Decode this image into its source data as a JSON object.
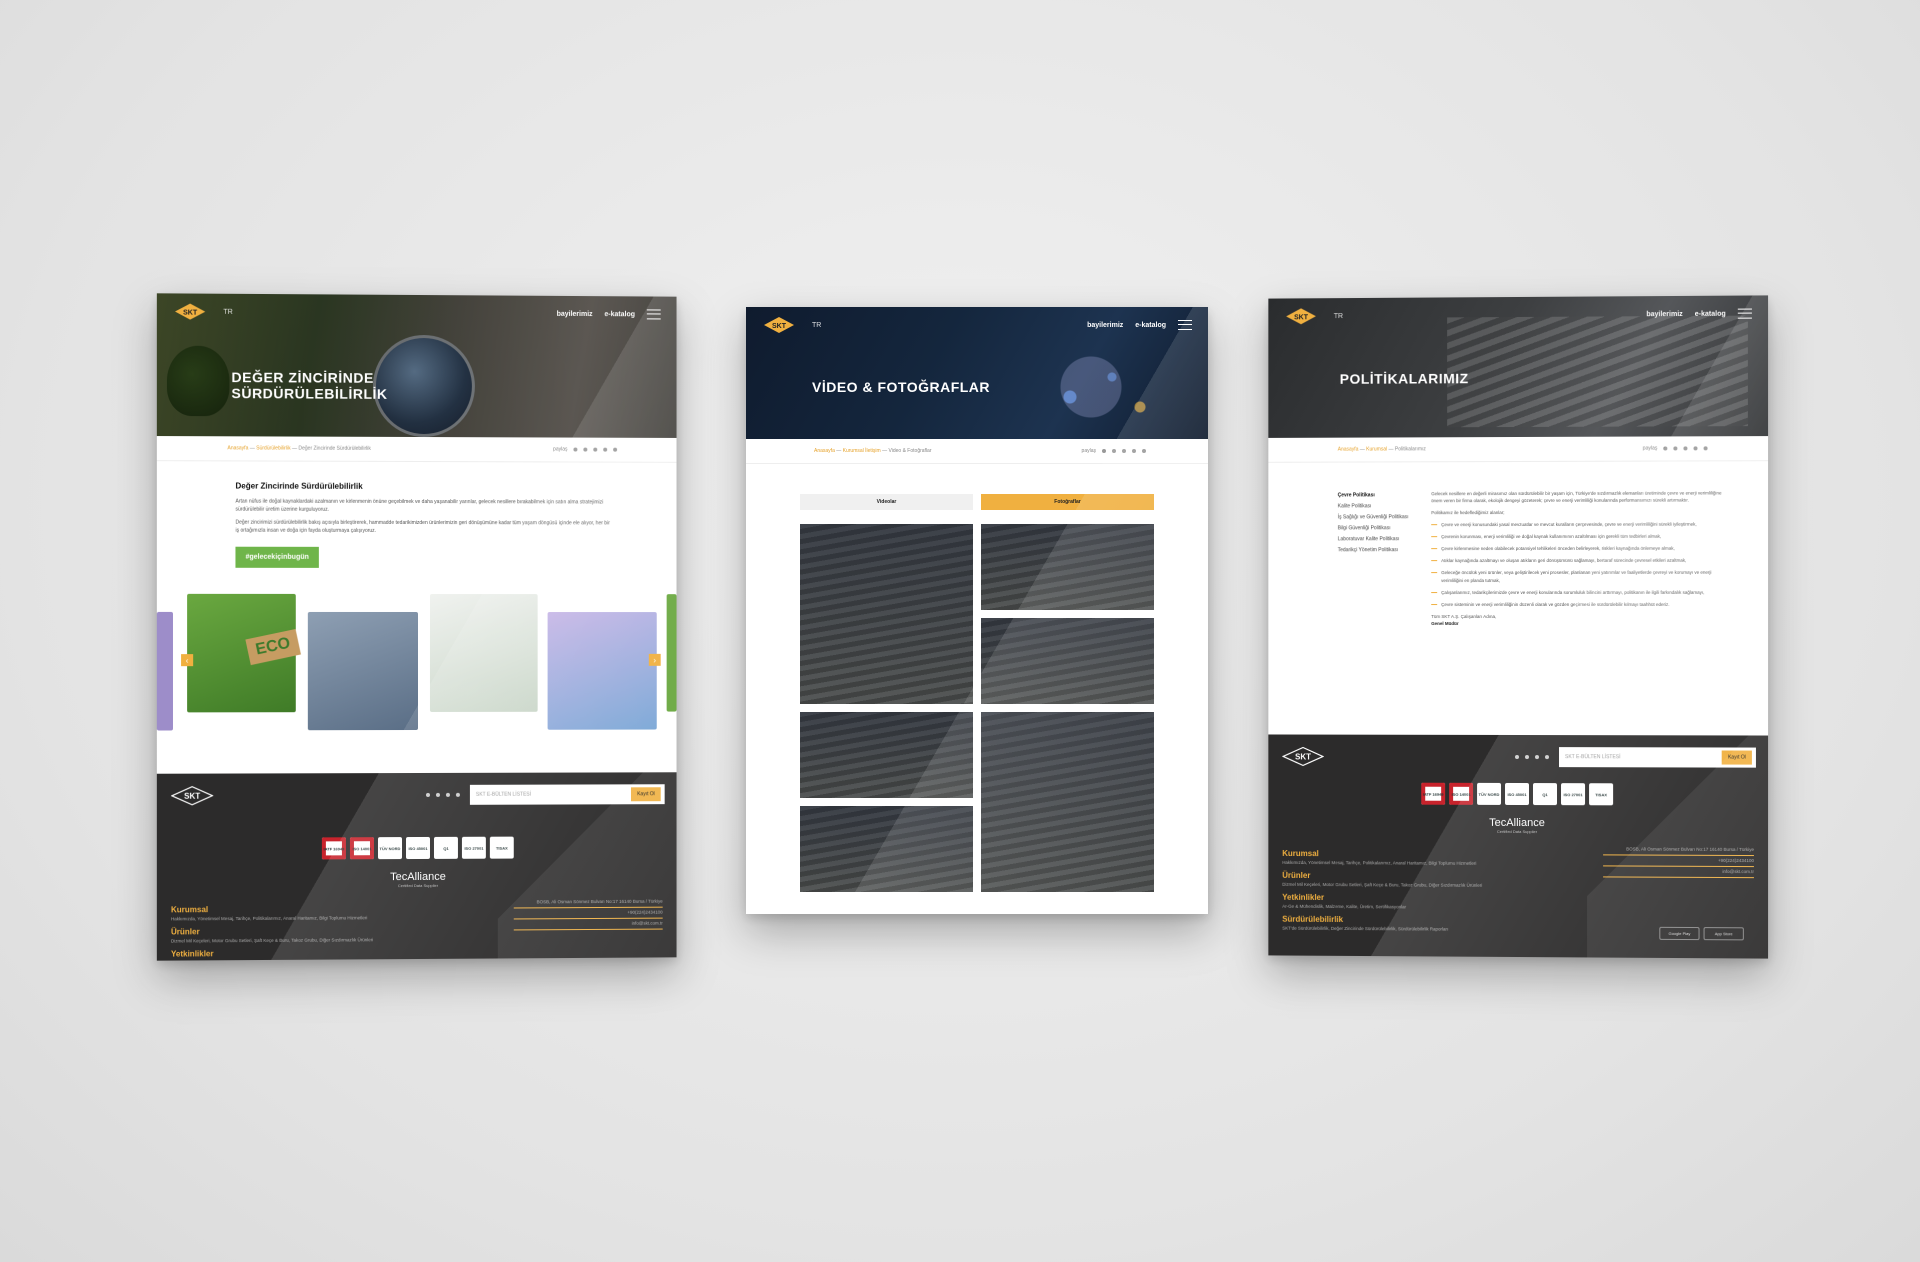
{
  "mockups": {
    "sustainability": {
      "nav": {
        "lang": "TR",
        "dealers": "bayilerimiz",
        "catalog": "e-katalog"
      },
      "hero_title": "DEĞER ZİNCİRİNDE SÜRDÜRÜLEBİLİRLİK",
      "breadcrumb": {
        "home": "Anasayfa",
        "parent": "Sürdürülebilirlik",
        "current": "Değer Zincirinde Sürdürülebilirlik"
      },
      "share_label": "paylaş",
      "heading": "Değer Zincirinde Sürdürülebilirlik",
      "para1": "Artan nüfus ile doğal kaynaklardaki azalmanın ve kirlenmenin önüne geçebilmek ve daha yaşanabilir yarınlar, gelecek nesillere bırakabilmek için satın alma stratejimizi sürdürülebilir üretim üzerine kurguluyoruz.",
      "para2": "Değer zincirimizi sürdürülebilirlik bakış açısıyla birleştirerek, hammadde tedarikimizden ürünlerimizin geri dönüşümüne kadar tüm yaşam döngüsü içinde ele alıyor, her bir iş ortağımızla insan ve doğa için fayda oluşturmaya çalışıyoruz.",
      "hashtag": "#gelecekiçinbugün",
      "eco_text": "ECO",
      "footer": {
        "newsletter_placeholder": "SKT E-BÜLTEN LİSTESİ",
        "newsletter_button": "Kayıt Ol",
        "tecalliance": "TecAlliance",
        "tec_sub": "Certified Data Supplier",
        "sections": [
          {
            "title": "Kurumsal",
            "text": "Hakkımızda, Yönetimsel Mesaj, Tarihçe, Politikalarımız, Anaral Haritamız, Bilgi Toplumu Hizmetleri"
          },
          {
            "title": "Ürünler",
            "text": "Dizmel Mil Keçeleri, Motor Grubu Setleri, Şaft Keçe & Buru, Takoz Grubu, Diğer Sızdırmazlık Ürünleri"
          },
          {
            "title": "Yetkinlikler",
            "text": ""
          }
        ],
        "address": "BOSB, Ali Osman Sönmez Bulvarı No:17 16140 Bursa / Türkiye",
        "phone": "+90(224)2434100",
        "email": "info@skt.com.tr"
      }
    },
    "gallery": {
      "nav": {
        "lang": "TR",
        "dealers": "bayilerimiz",
        "catalog": "e-katalog"
      },
      "hero_title": "VİDEO & FOTOĞRAFLAR",
      "breadcrumb": {
        "home": "Anasayfa",
        "parent": "Kurumsal İletişim",
        "current": "Video & Fotoğraflar"
      },
      "share_label": "paylaş",
      "tabs": [
        {
          "label": "Videolar",
          "active": false
        },
        {
          "label": "Fotoğraflar",
          "active": true
        }
      ],
      "photos": 6
    },
    "policies": {
      "nav": {
        "lang": "TR",
        "dealers": "bayilerimiz",
        "catalog": "e-katalog"
      },
      "hero_title": "POLİTİKALARIMIZ",
      "breadcrumb": {
        "home": "Anasayfa",
        "parent": "Kurumsal",
        "current": "Politikalarımız"
      },
      "share_label": "paylaş",
      "menu": [
        "Çevre Politikası",
        "Kalite Politikası",
        "İş Sağlığı ve Güvenliği Politikası",
        "Bilgi Güvenliği Politikası",
        "Laboratuvar Kalite Politikası",
        "Tedarikçi Yönetim Politikası"
      ],
      "intro": "Gelecek nesillere en değerli mirasımız olan sürdürülebilir bir yaşam için, Türkiye'de sızdırmazlık elemanları üretiminde çevre ve enerji verimliliğine önem veren bir firma olarak, ekolojik dengeyi gözeterek; çevre ve enerji verimliliği konularında performansımızı sürekli artırmaktır.",
      "commitments_title": "Politikamız ile hedeflediğimiz alanlar;",
      "commitments": [
        "Çevre ve enerji konusundaki yasal mevzuatlar ve mevcut kuralların çerçevesinde, çevre ve enerji verimliliğini sürekli iyileştirmek,",
        "Çevrenin korunması, enerji verimliliği ve doğal kaynak kullanımının azaltılması için gerekli tüm tedbirleri almak,",
        "Çevre kirlenmesine neden olabilecek potansiyel tehlikeleri önceden belirleyerek, riskleri kaynağında önlemeye almak,",
        "Atıklar kaynağında azaltmayı ve oluşan atıkların geri dönüşümünü sağlamayı, bertaraf sürecinde çevresel etkileri azaltmak,",
        "Geleceğe öncülük yeni ürünler, veya geliştirilecek yeni prosesler, planlanan yeni yatırımlar ve faaliyetlerde çevreyi ve korumayı ve enerji verimliliğini en planda tutmak,",
        "Çalışanlarımız, tedarikçilerimizde çevre ve enerji konularında sorumluluk bilincini arttırmayı, politikanın ile ilgili farkındalık sağlamayı,",
        "Çevre sisteminin ve enerji verimliliğinin düzenli olarak ve gözden geçirmesi ile sürdürülebilir kılmayı taahhüt ederiz."
      ],
      "signature_line": "Tüm SKT A.Ş. Çalışanları Adına,",
      "signature_role": "Genel Müdür",
      "footer": {
        "newsletter_placeholder": "SKT E-BÜLTEN LİSTESİ",
        "newsletter_button": "Kayıt Ol",
        "tecalliance": "TecAlliance",
        "tec_sub": "Certified Data Supplier",
        "sections": [
          {
            "title": "Kurumsal",
            "text": "Hakkımızda, Yönetimsel Mesaj, Tarihçe, Politikalarımız, Anaral Haritamız, Bilgi Toplumu Hizmetleri"
          },
          {
            "title": "Ürünler",
            "text": "Dizmel Mil Keçeleri, Motor Grubu Setleri, Şaft Keçe & Buru, Takoz Grubu, Diğer Sızdırmazlık Ürünleri"
          },
          {
            "title": "Yetkinlikler",
            "text": "Ar-Ge & Mühendislik, Malzeme, Kalite, Üretim, Sertifikasyonlar"
          },
          {
            "title": "Sürdürülebilirlik",
            "text": "SKT'de Sürdürülebilirlik, Değer Zincirinde Sürdürülebilirlik, Sürdürülebilirlik Raporları"
          }
        ],
        "address": "BOSB, Ali Osman Sönmez Bulvarı No:17 16140 Bursa / Türkiye",
        "phone": "+90(224)2434100",
        "email": "info@skt.com.tr",
        "google_play": "Google Play",
        "app_store": "App Store"
      }
    }
  },
  "certs": [
    "IATF 16949",
    "ISO 14001",
    "TÜV NORD",
    "ISO 45001",
    "Q1",
    "ISO 27001",
    "TISAX"
  ],
  "colors": {
    "accent": "#f0b040",
    "footer": "#2c2b2b",
    "green": "#6fb54a"
  }
}
